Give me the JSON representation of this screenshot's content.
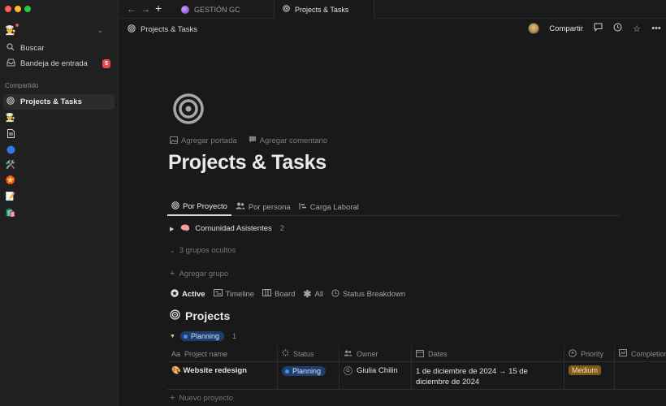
{
  "sidebar": {
    "search_label": "Buscar",
    "inbox_label": "Bandeja de entrada",
    "inbox_badge": "5",
    "section_label": "Compartido",
    "active_page": "Projects & Tasks",
    "pages": [
      {
        "icon": "crown-user"
      },
      {
        "icon": "document"
      },
      {
        "icon": "blue-circle"
      },
      {
        "icon": "tools"
      },
      {
        "icon": "pinwheel"
      },
      {
        "icon": "memo"
      },
      {
        "icon": "shopping-bags"
      }
    ]
  },
  "tabs": [
    {
      "label": "GESTIÓN GC"
    },
    {
      "label": "Projects & Tasks"
    }
  ],
  "topbar": {
    "breadcrumb": "Projects & Tasks",
    "share_label": "Compartir"
  },
  "page": {
    "add_cover": "Agregar portada",
    "add_comment": "Agregar comentario",
    "title": "Projects & Tasks",
    "views": [
      {
        "label": "Por Proyecto"
      },
      {
        "label": "Por persona"
      },
      {
        "label": "Carga Laboral"
      }
    ],
    "group": {
      "label": "Comunidad Asistentes",
      "count": "2"
    },
    "hidden_groups": "3 grupos ocultos",
    "add_group": "Agregar grupo",
    "views2": [
      {
        "label": "Active"
      },
      {
        "label": "Timeline"
      },
      {
        "label": "Board"
      },
      {
        "label": "All"
      },
      {
        "label": "Status Breakdown"
      }
    ],
    "db_title": "Projects",
    "subgroup": {
      "label": "Planning",
      "count": "1"
    },
    "columns": [
      {
        "label": "Project name",
        "icon": "Aa"
      },
      {
        "label": "Status"
      },
      {
        "label": "Owner"
      },
      {
        "label": "Dates"
      },
      {
        "label": "Priority"
      },
      {
        "label": "Completion"
      }
    ],
    "rows": [
      {
        "name": "Website redesign",
        "status": "Planning",
        "owner_initial": "G",
        "owner": "Giulia Chilin",
        "dates": "1 de diciembre de 2024 → 15 de diciembre de 2024",
        "priority": "Medium"
      }
    ],
    "new_item": "Nuevo proyecto"
  }
}
